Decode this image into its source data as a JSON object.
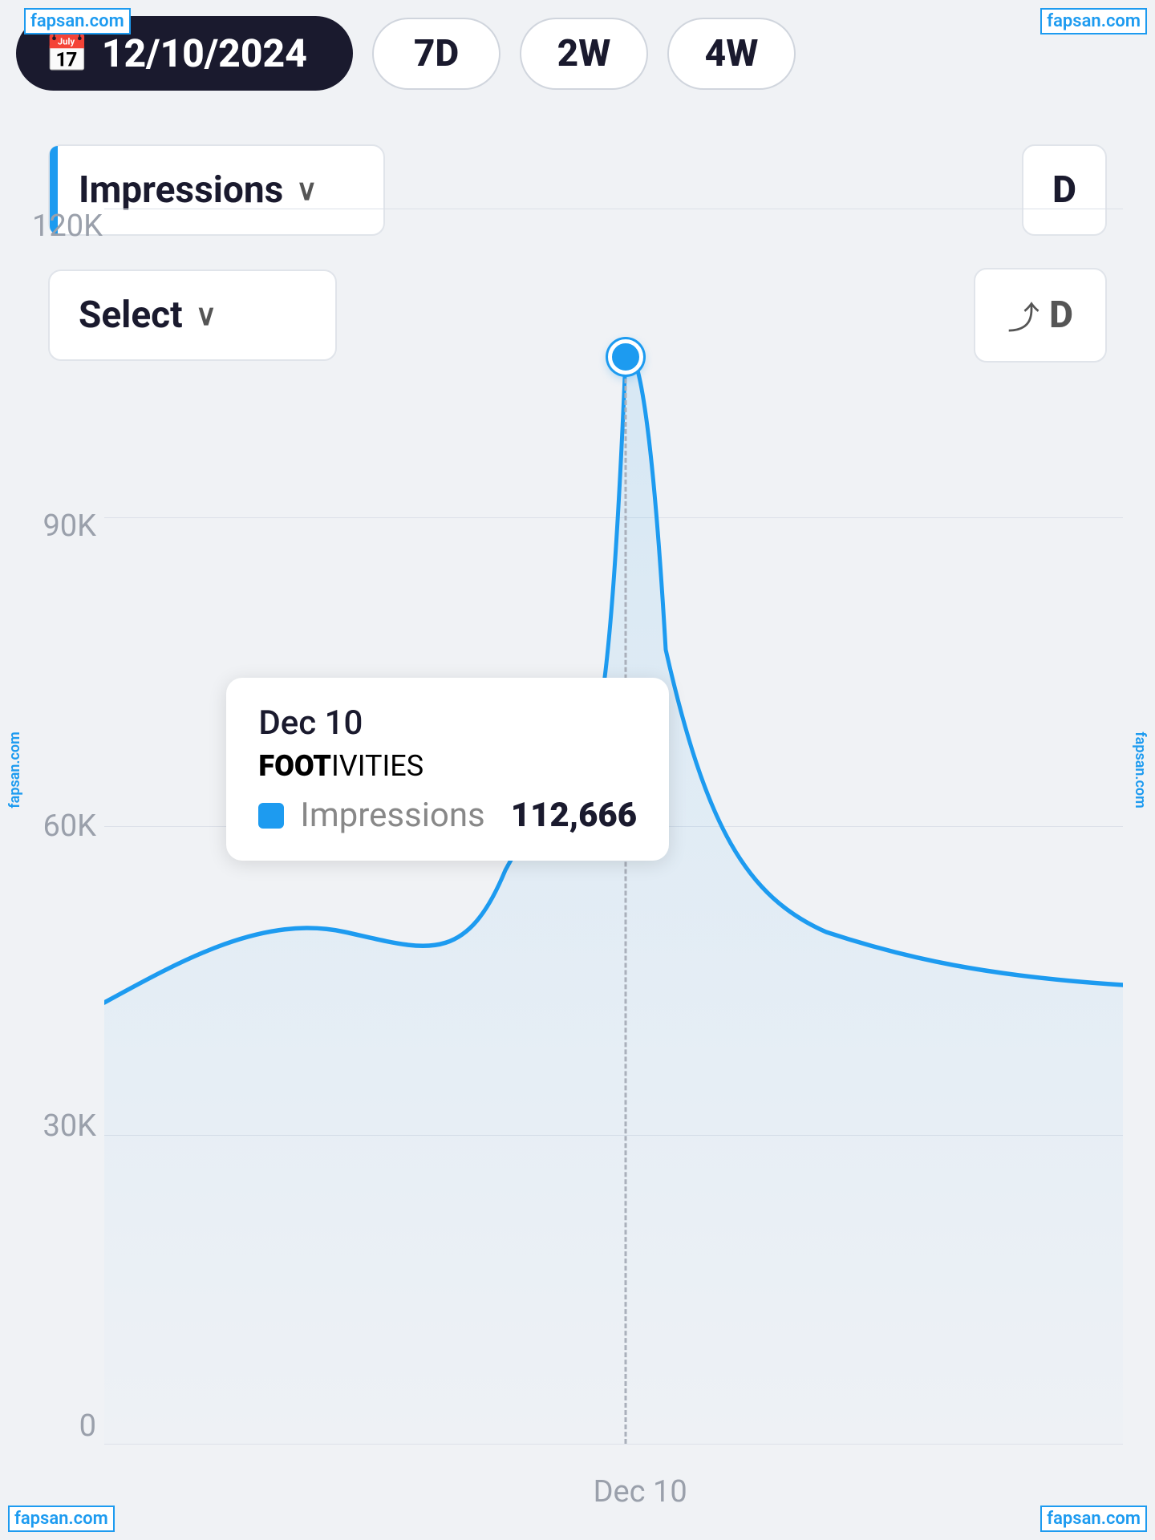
{
  "watermarks": {
    "text": "fapsan.com"
  },
  "header": {
    "date_label": "12/10/2024",
    "calendar_icon": "📅",
    "period_buttons": [
      "7D",
      "2W",
      "4W"
    ]
  },
  "filters": {
    "metric_label": "Impressions",
    "metric_chevron": "∨",
    "select_label": "Select",
    "select_chevron": "∨",
    "right_label": "D",
    "chart_icon": "⤴"
  },
  "chart": {
    "y_axis": [
      "120K",
      "90K",
      "60K",
      "30K",
      "0"
    ],
    "x_axis": [
      "Dec 10"
    ],
    "tooltip": {
      "date": "Dec 10",
      "brand_prefix": "FOOT",
      "brand_suffix": "IVITIES",
      "metric_label": "Impressions",
      "metric_value": "112,666"
    },
    "data_point": {
      "x_percent": 46,
      "y_percent": 12
    }
  }
}
